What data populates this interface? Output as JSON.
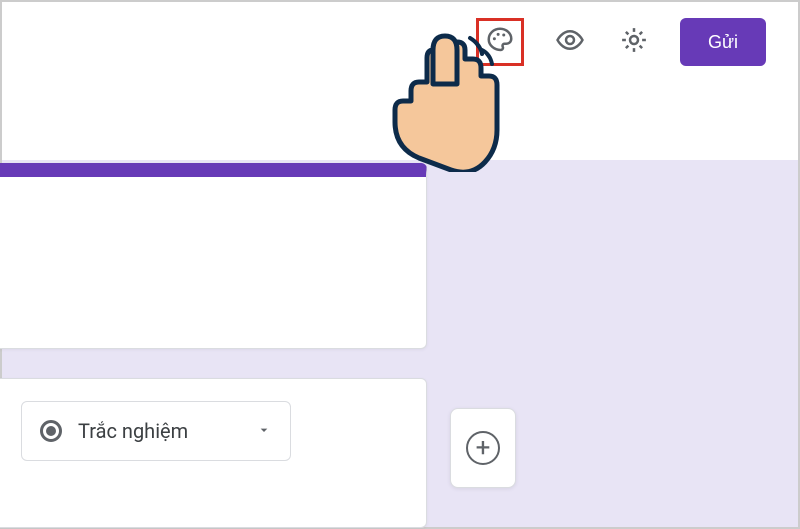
{
  "toolbar": {
    "theme_icon": "palette-icon",
    "preview_icon": "eye-icon",
    "settings_icon": "gear-icon",
    "send_label": "Gửi"
  },
  "question": {
    "type_label": "Trắc nghiệm"
  },
  "side_tools": {
    "add_icon": "plus-icon"
  },
  "annotation": {
    "pointer": "hand-pointer"
  },
  "colors": {
    "accent": "#673ab7",
    "canvas_bg": "#e8e4f5",
    "highlight": "#d93025"
  }
}
